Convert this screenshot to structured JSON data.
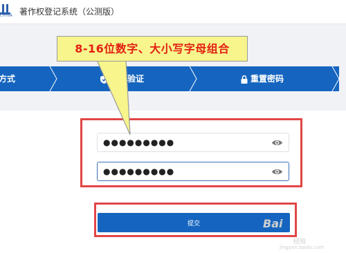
{
  "app": {
    "logo_subtext": "CHINA",
    "title": "著作权登记系统（公测版）"
  },
  "steps": [
    {
      "label": "方式"
    },
    {
      "label": "账号验证",
      "icon": "shield-check-icon"
    },
    {
      "label": "重置密码",
      "icon": "lock-icon"
    }
  ],
  "tooltip": {
    "text": "8-16位数字、大小写字母组合"
  },
  "form": {
    "password": {
      "value": "●●●●●●●●●",
      "icon": "eye-icon"
    },
    "confirm_password": {
      "value": "●●●●●●●●●",
      "icon": "eye-icon"
    },
    "submit_label": "提交"
  },
  "watermark": {
    "brand": "Bai",
    "brand2": "经验",
    "url": "jingyan.baidu.com"
  },
  "colors": {
    "primary": "#1565c0",
    "annotation_red": "#e14545",
    "tooltip_bg": "#f7f58c",
    "tooltip_text": "#e31e12"
  }
}
